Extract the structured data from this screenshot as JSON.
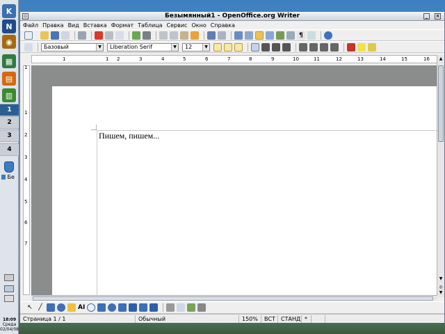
{
  "panel": {
    "launcher_icons": [
      {
        "name": "kde-menu-icon",
        "color": "#3a6fb0",
        "glyph": "K"
      },
      {
        "name": "netscape-icon",
        "color": "#1f4b8a",
        "glyph": "N"
      },
      {
        "name": "eye-icon",
        "color": "#a56a10",
        "glyph": "◉"
      },
      {
        "name": "calc-icon",
        "color": "#2f7b3f",
        "glyph": "▦"
      },
      {
        "name": "impress-icon",
        "color": "#d36a10",
        "glyph": "▤"
      },
      {
        "name": "spreadsheet-icon",
        "color": "#3a8a2f",
        "glyph": "▥"
      }
    ],
    "desktops": [
      "1",
      "2",
      "3",
      "4"
    ],
    "active_desktop": "1",
    "taskbar_label": "Бе",
    "clock": {
      "time": "18:09",
      "day": "Среда",
      "date": "02/04/08"
    }
  },
  "window": {
    "title": "Безымянный1 - OpenOffice.org Writer",
    "menu": [
      "Файл",
      "Правка",
      "Вид",
      "Вставка",
      "Формат",
      "Таблица",
      "Сервис",
      "Окно",
      "Справка"
    ]
  },
  "formatting": {
    "style": "Базовый",
    "font": "Liberation Serif",
    "size": "12"
  },
  "ruler": {
    "labels": [
      "1",
      "1",
      "2",
      "3",
      "4",
      "5",
      "6",
      "7",
      "8",
      "9",
      "10",
      "11",
      "12",
      "13",
      "14",
      "15",
      "16"
    ],
    "vertical_labels": [
      "1",
      "1",
      "2",
      "3",
      "4",
      "5",
      "6",
      "7"
    ]
  },
  "document": {
    "text": "Пишем, пишем..."
  },
  "drawing": {
    "text_tool": "AI"
  },
  "status": {
    "page": "Страница  1 / 1",
    "style": "Обычный",
    "zoom": "150%",
    "insert_mode": "ВСТ",
    "selection_mode": "СТАНД",
    "modified": "*"
  }
}
